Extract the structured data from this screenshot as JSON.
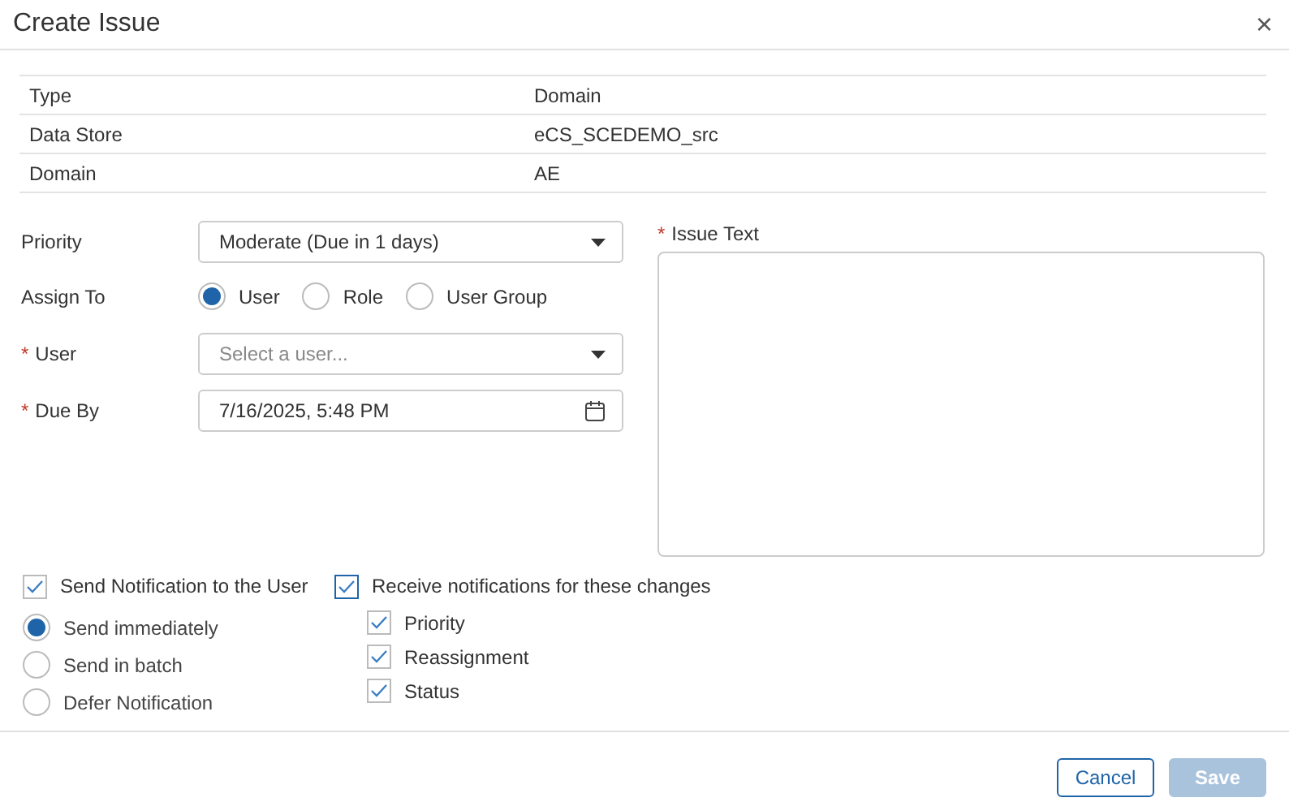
{
  "window": {
    "title": "Create Issue",
    "close": "×"
  },
  "info_table": [
    {
      "label": "Type",
      "value": "Domain"
    },
    {
      "label": "Data Store",
      "value": "eCS_SCEDEMO_src"
    },
    {
      "label": "Domain",
      "value": "AE"
    }
  ],
  "priority": {
    "label": "Priority",
    "value": "Moderate (Due in 1 days)"
  },
  "assign_to": {
    "label": "Assign To",
    "options": [
      {
        "label": "User",
        "selected": true
      },
      {
        "label": "Role",
        "selected": false
      },
      {
        "label": "User Group",
        "selected": false
      }
    ]
  },
  "user": {
    "required_mark": "*",
    "label": "User",
    "placeholder": "Select a user..."
  },
  "due_by": {
    "required_mark": "*",
    "label": "Due By",
    "value": "7/16/2025, 5:48 PM"
  },
  "issue_text": {
    "required_mark": "*",
    "label": "Issue Text"
  },
  "send_notification": {
    "label": "Send Notification to the User",
    "checked": true
  },
  "send_options": [
    {
      "label": "Send immediately",
      "selected": true
    },
    {
      "label": "Send in batch",
      "selected": false
    },
    {
      "label": "Defer Notification",
      "selected": false
    }
  ],
  "receive_notifications": {
    "label": "Receive notifications for these changes",
    "checked": true,
    "focused": true
  },
  "changes": [
    {
      "label": "Priority",
      "checked": true
    },
    {
      "label": "Reassignment",
      "checked": true
    },
    {
      "label": "Status",
      "checked": true
    }
  ],
  "buttons": [
    {
      "label": "Cancel",
      "kind": "secondary",
      "disabled": false
    },
    {
      "label": "Save",
      "kind": "primary",
      "disabled": true
    }
  ]
}
